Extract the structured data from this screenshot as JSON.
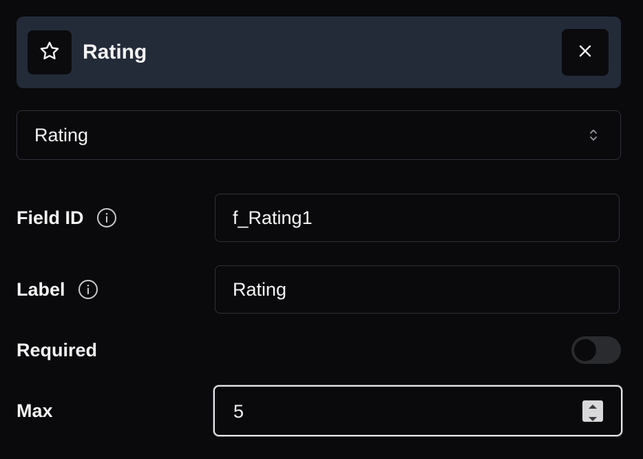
{
  "header": {
    "title": "Rating",
    "icon": "star-icon",
    "close_icon": "close-icon"
  },
  "field_type_select": {
    "value": "Rating",
    "icon": "chevron-up-down-icon"
  },
  "fields": {
    "field_id": {
      "label": "Field ID",
      "value": "f_Rating1",
      "info_icon": "info-icon"
    },
    "label": {
      "label": "Label",
      "value": "Rating",
      "info_icon": "info-icon"
    },
    "required": {
      "label": "Required",
      "checked": false
    },
    "max": {
      "label": "Max",
      "value": "5"
    }
  },
  "colors": {
    "background": "#0a0a0c",
    "header_bg": "#232b39",
    "border": "#2e323a",
    "text": "#f4f4f5",
    "focus_border": "#e8e8ea"
  }
}
